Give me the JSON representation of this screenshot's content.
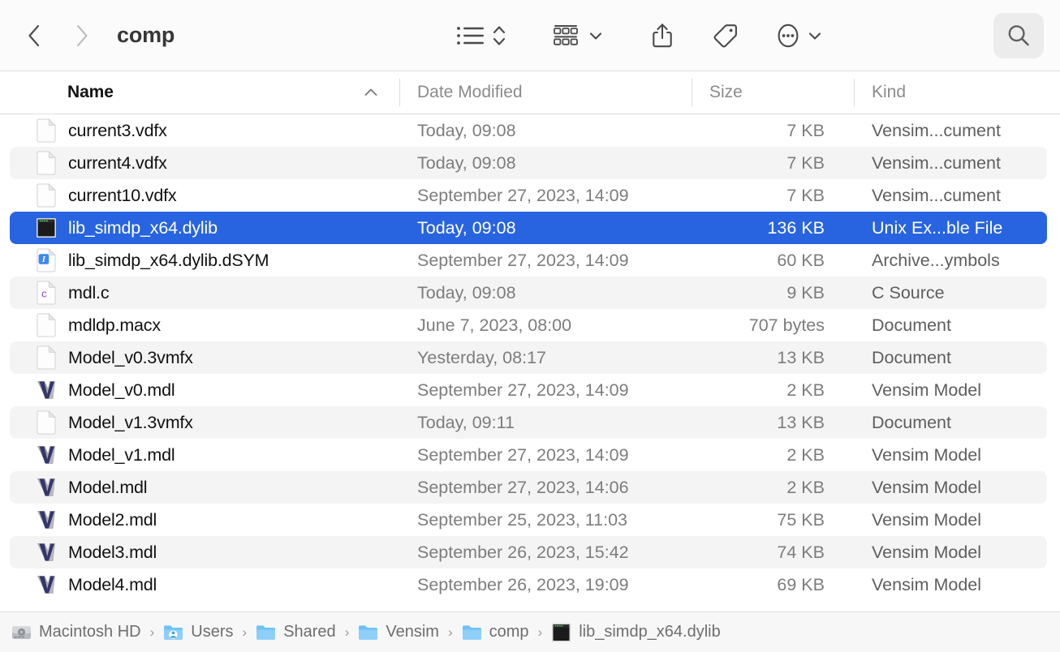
{
  "window": {
    "title": "comp"
  },
  "toolbar": {
    "back_label": "Back",
    "forward_label": "Forward",
    "list_view_label": "List View",
    "sort_label": "Sort",
    "group_label": "Group",
    "group_caret_label": "Group Options",
    "share_label": "Share",
    "tag_label": "Tag",
    "more_label": "More",
    "more_caret_label": "More Options",
    "search_label": "Search",
    "icons": {
      "back": "chevron-left-icon",
      "forward": "chevron-right-icon",
      "list_view": "list-view-icon",
      "sort": "sort-updown-icon",
      "group": "group-grid-icon",
      "caret": "chevron-down-icon",
      "share": "share-icon",
      "tag": "tag-icon",
      "more": "ellipsis-circle-icon",
      "search": "search-icon"
    }
  },
  "columns": {
    "name": "Name",
    "date_modified": "Date Modified",
    "size": "Size",
    "kind": "Kind",
    "sort_direction": "ascending",
    "sort_column": "Name"
  },
  "files": [
    {
      "name": "current3.vdfx",
      "date": "Today, 09:08",
      "size": "7 KB",
      "kind": "Vensim...cument",
      "icon": "blank-document-icon",
      "selected": false
    },
    {
      "name": "current4.vdfx",
      "date": "Today, 09:08",
      "size": "7 KB",
      "kind": "Vensim...cument",
      "icon": "blank-document-icon",
      "selected": false
    },
    {
      "name": "current10.vdfx",
      "date": "September 27, 2023, 14:09",
      "size": "7 KB",
      "kind": "Vensim...cument",
      "icon": "blank-document-icon",
      "selected": false
    },
    {
      "name": "lib_simdp_x64.dylib",
      "date": "Today, 09:08",
      "size": "136 KB",
      "kind": "Unix Ex...ble File",
      "icon": "terminal-executable-icon",
      "selected": true
    },
    {
      "name": "lib_simdp_x64.dylib.dSYM",
      "date": "September 27, 2023, 14:09",
      "size": "60 KB",
      "kind": "Archive...ymbols",
      "icon": "archive-symbols-icon",
      "selected": false
    },
    {
      "name": "mdl.c",
      "date": "Today, 09:08",
      "size": "9 KB",
      "kind": "C Source",
      "icon": "c-source-icon",
      "selected": false
    },
    {
      "name": "mdldp.macx",
      "date": "June 7, 2023, 08:00",
      "size": "707 bytes",
      "kind": "Document",
      "icon": "blank-document-icon",
      "selected": false
    },
    {
      "name": "Model_v0.3vmfx",
      "date": "Yesterday, 08:17",
      "size": "13 KB",
      "kind": "Document",
      "icon": "blank-document-icon",
      "selected": false
    },
    {
      "name": "Model_v0.mdl",
      "date": "September 27, 2023, 14:09",
      "size": "2 KB",
      "kind": "Vensim Model",
      "icon": "vensim-model-icon",
      "selected": false
    },
    {
      "name": "Model_v1.3vmfx",
      "date": "Today, 09:11",
      "size": "13 KB",
      "kind": "Document",
      "icon": "blank-document-icon",
      "selected": false
    },
    {
      "name": "Model_v1.mdl",
      "date": "September 27, 2023, 14:09",
      "size": "2 KB",
      "kind": "Vensim Model",
      "icon": "vensim-model-icon",
      "selected": false
    },
    {
      "name": "Model.mdl",
      "date": "September 27, 2023, 14:06",
      "size": "2 KB",
      "kind": "Vensim Model",
      "icon": "vensim-model-icon",
      "selected": false
    },
    {
      "name": "Model2.mdl",
      "date": "September 25, 2023, 11:03",
      "size": "75 KB",
      "kind": "Vensim Model",
      "icon": "vensim-model-icon",
      "selected": false
    },
    {
      "name": "Model3.mdl",
      "date": "September 26, 2023, 15:42",
      "size": "74 KB",
      "kind": "Vensim Model",
      "icon": "vensim-model-icon",
      "selected": false
    },
    {
      "name": "Model4.mdl",
      "date": "September 26, 2023, 19:09",
      "size": "69 KB",
      "kind": "Vensim Model",
      "icon": "vensim-model-icon",
      "selected": false
    }
  ],
  "path_bar": [
    {
      "label": "Macintosh HD",
      "icon": "hard-drive-icon"
    },
    {
      "label": "Users",
      "icon": "users-folder-icon"
    },
    {
      "label": "Shared",
      "icon": "folder-icon"
    },
    {
      "label": "Vensim",
      "icon": "folder-icon"
    },
    {
      "label": "comp",
      "icon": "folder-icon"
    },
    {
      "label": "lib_simdp_x64.dylib",
      "icon": "terminal-executable-icon"
    }
  ],
  "colors": {
    "selection_blue": "#2864e0",
    "stripe_gray": "#f4f4f4",
    "toolbar_bg": "#fbfbfb",
    "path_bar_bg": "#f7f7f7",
    "search_btn_bg": "#ececec",
    "folder_blue": "#6fc2f5",
    "c_source_purple": "#8b44d6",
    "vensim_navy": "#33376b"
  }
}
